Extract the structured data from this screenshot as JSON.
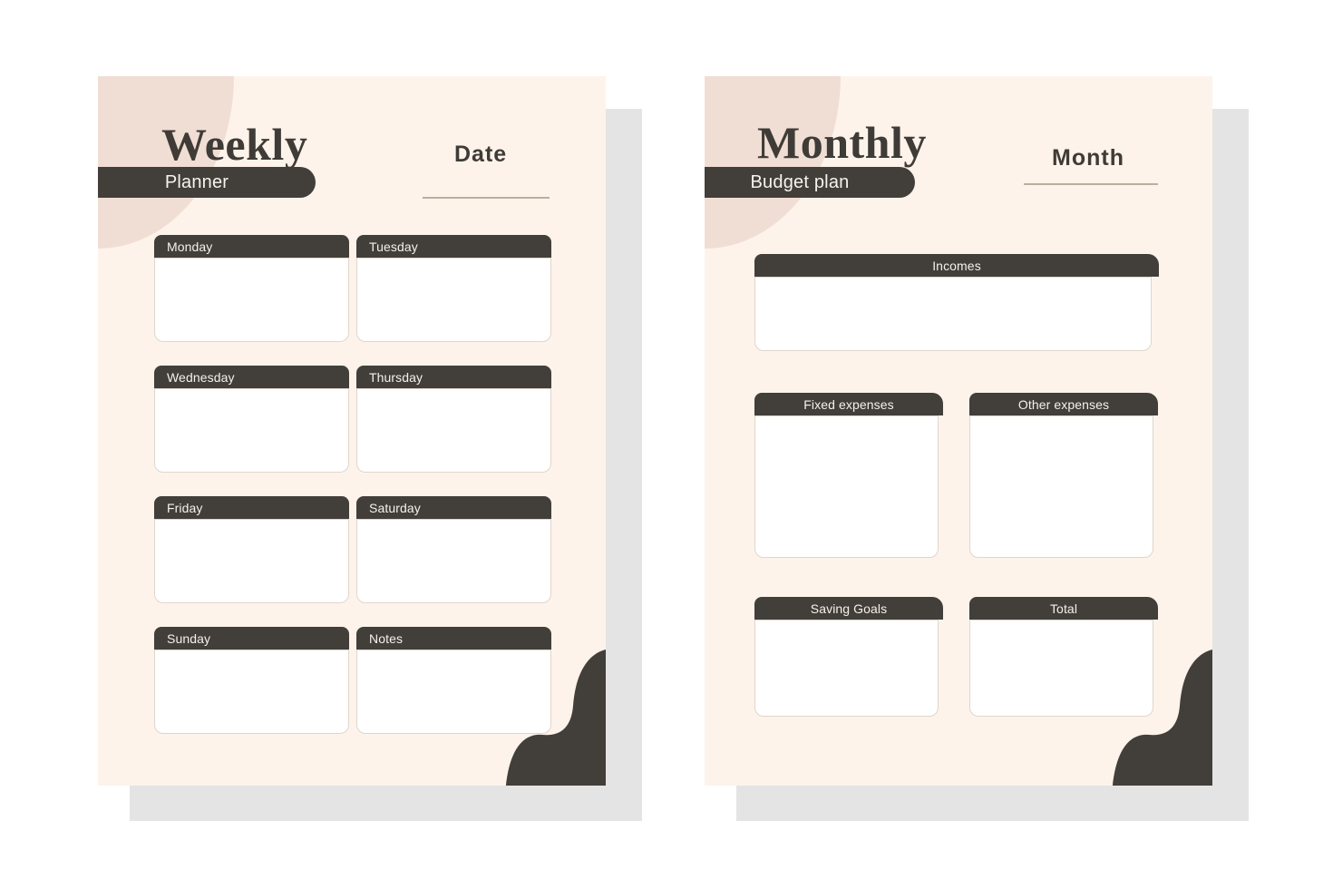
{
  "theme": {
    "cream": "#fdf3ea",
    "dark": "#423e3a",
    "pink": "#f0ded4",
    "shadow": "#e4e4e4",
    "card_border": "#ded6cc",
    "rule": "#b8b0a0",
    "card_body": "#ffffff"
  },
  "weekly": {
    "title": "Weekly",
    "subtitle": "Planner",
    "field_label": "Date",
    "field_value": "",
    "cards": [
      {
        "label": "Monday"
      },
      {
        "label": "Tuesday"
      },
      {
        "label": "Wednesday"
      },
      {
        "label": "Thursday"
      },
      {
        "label": "Friday"
      },
      {
        "label": "Saturday"
      },
      {
        "label": "Sunday"
      },
      {
        "label": "Notes"
      }
    ]
  },
  "monthly": {
    "title": "Monthly",
    "subtitle": "Budget plan",
    "field_label": "Month",
    "field_value": "",
    "incomes": {
      "label": "Incomes",
      "value": ""
    },
    "cards": [
      {
        "label": "Fixed expenses",
        "value": ""
      },
      {
        "label": "Other expenses",
        "value": ""
      },
      {
        "label": "Saving Goals",
        "value": ""
      },
      {
        "label": "Total",
        "value": ""
      }
    ]
  }
}
